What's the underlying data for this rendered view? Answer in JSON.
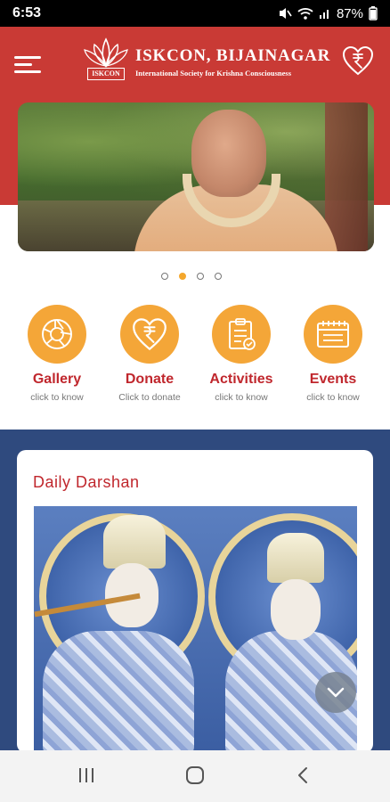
{
  "status_bar": {
    "time": "6:53",
    "battery": "87%"
  },
  "header": {
    "brand_title": "ISKCON, BIJAINAGAR",
    "brand_subtitle": "International Society for Krishna Consciousness",
    "badge_text": "ISKCON",
    "accent_color": "#c93a35"
  },
  "banner": {
    "slide_count": 4,
    "active_slide": 2
  },
  "actions": [
    {
      "label": "Gallery",
      "sub": "click to know",
      "icon": "shutter-icon"
    },
    {
      "label": "Donate",
      "sub": "Click to donate",
      "icon": "rupee-heart-icon"
    },
    {
      "label": "Activities",
      "sub": "click to know",
      "icon": "clipboard-icon"
    },
    {
      "label": "Events",
      "sub": "click to know",
      "icon": "calendar-icon"
    }
  ],
  "darshan": {
    "title": "Daily Darshan"
  },
  "colors": {
    "orange": "#f4a638",
    "red": "#c0272d",
    "navy": "#2f4a7e"
  }
}
